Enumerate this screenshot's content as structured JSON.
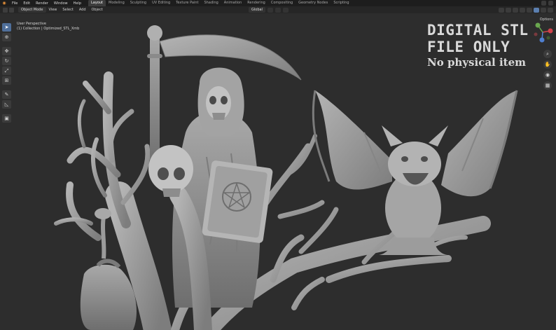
{
  "topbar": {
    "menus": [
      "File",
      "Edit",
      "Render",
      "Window",
      "Help"
    ],
    "workspaces": [
      "Layout",
      "Modeling",
      "Sculpting",
      "UV Editing",
      "Texture Paint",
      "Shading",
      "Animation",
      "Rendering",
      "Compositing",
      "Geometry Nodes",
      "Scripting"
    ],
    "active_workspace": "Layout"
  },
  "header": {
    "mode": "Object Mode",
    "menus": [
      "View",
      "Select",
      "Add",
      "Object"
    ],
    "orientation": "Global"
  },
  "viewport": {
    "view_name": "User Perspective",
    "collection": "(1) Collection | Optimized_STL_Xmb"
  },
  "options_label": "Options",
  "watermark": {
    "line1": "DIGITAL STL",
    "line2": "FILE ONLY",
    "line3": "No physical item"
  },
  "colors": {
    "background": "#2d2d2d",
    "model": "#9a9a9a",
    "accent": "#4f6f9a"
  }
}
